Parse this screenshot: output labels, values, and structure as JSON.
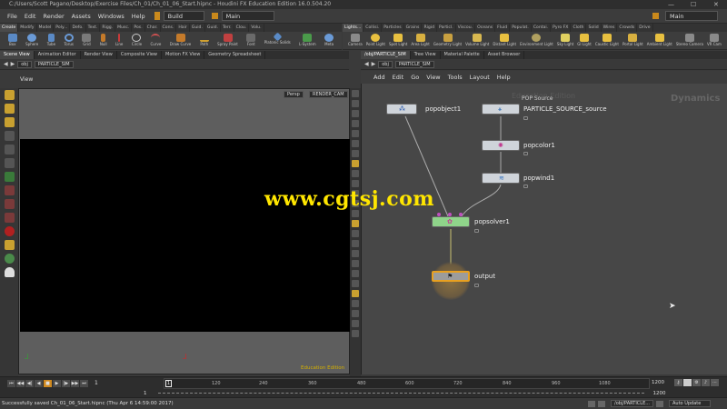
{
  "title_bar": {
    "path": "C:/Users/Scott Pagano/Desktop/Exercise Files/Ch_01/Ch_01_06_Start.hipnc - Houdini FX Education Edition 16.0.504.20",
    "min": "—",
    "max": "☐",
    "close": "✕"
  },
  "menu": {
    "items": [
      "File",
      "Edit",
      "Render",
      "Assets",
      "Windows",
      "Help"
    ],
    "build_select": "Build",
    "desk_select": "Main",
    "desk_select_right": "Main"
  },
  "shelf_left": {
    "tabs": [
      "Create",
      "Modify",
      "Model",
      "Poly...",
      "Defo.",
      "Text.",
      "Rigg.",
      "Musc.",
      "Pos.",
      "Char.",
      "Cons.",
      "Hair",
      "Guid.",
      "Guid.",
      "Terr.",
      "Clou.",
      "Volu."
    ],
    "tools": [
      "Box",
      "Sphere",
      "Tube",
      "Torus",
      "Grid",
      "Null",
      "Line",
      "Circle",
      "Curve",
      "Draw Curve",
      "Path",
      "Spray Paint",
      "Font",
      "Platonic Solids",
      "L-System",
      "Meta"
    ]
  },
  "shelf_right": {
    "tabs": [
      "Lights...",
      "Collisi.",
      "Particles",
      "Grains",
      "Rigid",
      "Particl.",
      "Viscou.",
      "Oceans",
      "Fluid",
      "Populat.",
      "Contai.",
      "Pyro FX",
      "Cloth",
      "Solid",
      "Wires",
      "Crowds",
      "Drive"
    ],
    "tools": [
      "Camera",
      "Point Light",
      "Spot Light",
      "Area Light",
      "Geometry Light",
      "Volume Light",
      "Distant Light",
      "Environment Light",
      "Sky Light",
      "GI Light",
      "Caustic Light",
      "Portal Light",
      "Ambient Light",
      "Stereo Camera",
      "VR Cam"
    ]
  },
  "left_pane": {
    "tabs": [
      "Scene View",
      "Animation Editor",
      "Render View",
      "Composite View",
      "Motion FX View",
      "Geometry Spreadsheet"
    ],
    "path": [
      "obj",
      "PARTICLE_SIM"
    ],
    "view_label": "View",
    "persp": "Persp",
    "camera": "RENDER_CAM",
    "edition": "Education Edition"
  },
  "right_pane": {
    "tabs": [
      "/obj/PARTICLE_SIM",
      "Tree View",
      "Material Palette",
      "Asset Browser"
    ],
    "path": [
      "obj",
      "PARTICLE_SIM"
    ],
    "menu": [
      "Add",
      "Edit",
      "Go",
      "View",
      "Tools",
      "Layout",
      "Help"
    ],
    "context": "Dynamics",
    "edition_bg": "Education Edition",
    "source_caption": "POP Source",
    "nodes": [
      {
        "name": "popobject1",
        "color": "#cfd4da"
      },
      {
        "name": "PARTICLE_SOURCE_source",
        "color": "#cfd4da"
      },
      {
        "name": "popcolor1",
        "color": "#cfd4da"
      },
      {
        "name": "popwind1",
        "color": "#cfd4da"
      },
      {
        "name": "popsolver1",
        "color": "#8fd48a"
      },
      {
        "name": "output",
        "color": "#9c9c9c"
      }
    ]
  },
  "watermark": "www.cgtsj.com",
  "timeline": {
    "ticks": [
      "1",
      "120",
      "240",
      "360",
      "480",
      "600",
      "720",
      "840",
      "960",
      "1080"
    ],
    "current_frame": "1",
    "start": "1",
    "end_a": "1200",
    "end_b": "1200",
    "frame_field": "1"
  },
  "status": {
    "message": "Successfully saved Ch_01_06_Start.hipnc (Thu Apr 6 14:59:00 2017)",
    "path": "/obj/PARTICLE...",
    "update": "Auto Update"
  }
}
